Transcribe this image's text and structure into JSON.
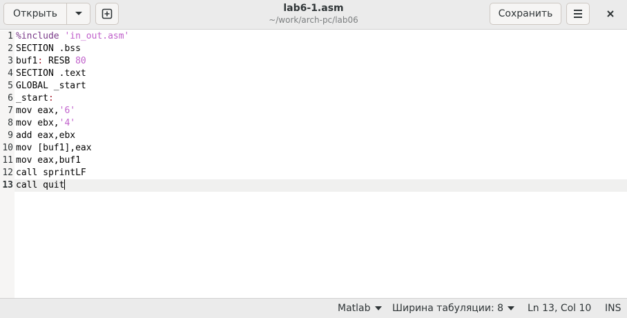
{
  "header": {
    "open_label": "Открыть",
    "save_label": "Сохранить",
    "title": "lab6-1.asm",
    "subtitle": "~/work/arch-pc/lab06"
  },
  "editor": {
    "current_line": 13,
    "lines": [
      {
        "n": "1",
        "tokens": [
          {
            "t": "%include ",
            "c": "inc"
          },
          {
            "t": "'in_out.asm'",
            "c": "str"
          }
        ]
      },
      {
        "n": "2",
        "tokens": [
          {
            "t": "SECTION .bss",
            "c": ""
          }
        ]
      },
      {
        "n": "3",
        "tokens": [
          {
            "t": "buf1",
            "c": ""
          },
          {
            "t": ":",
            "c": "kw"
          },
          {
            "t": " RESB ",
            "c": ""
          },
          {
            "t": "80",
            "c": "num"
          }
        ]
      },
      {
        "n": "4",
        "tokens": [
          {
            "t": "SECTION .text",
            "c": ""
          }
        ]
      },
      {
        "n": "5",
        "tokens": [
          {
            "t": "GLOBAL _start",
            "c": ""
          }
        ]
      },
      {
        "n": "6",
        "tokens": [
          {
            "t": "_start",
            "c": ""
          },
          {
            "t": ":",
            "c": "kw"
          }
        ]
      },
      {
        "n": "7",
        "tokens": [
          {
            "t": "mov eax,",
            "c": ""
          },
          {
            "t": "'6'",
            "c": "str"
          }
        ]
      },
      {
        "n": "8",
        "tokens": [
          {
            "t": "mov ebx,",
            "c": ""
          },
          {
            "t": "'4'",
            "c": "str"
          }
        ]
      },
      {
        "n": "9",
        "tokens": [
          {
            "t": "add eax,ebx",
            "c": ""
          }
        ]
      },
      {
        "n": "10",
        "tokens": [
          {
            "t": "mov [buf1],eax",
            "c": ""
          }
        ]
      },
      {
        "n": "11",
        "tokens": [
          {
            "t": "mov eax,buf1",
            "c": ""
          }
        ]
      },
      {
        "n": "12",
        "tokens": [
          {
            "t": "call sprintLF",
            "c": ""
          }
        ]
      },
      {
        "n": "13",
        "tokens": [
          {
            "t": "call quit",
            "c": ""
          }
        ]
      }
    ]
  },
  "status": {
    "language": "Matlab",
    "tab_width": "Ширина табуляции: 8",
    "position": "Ln 13, Col 10",
    "mode": "INS"
  },
  "icons": {
    "dropdown": "chevron-down-icon",
    "new_tab": "new-tab-icon",
    "menu": "hamburger-menu-icon",
    "close": "close-icon"
  }
}
